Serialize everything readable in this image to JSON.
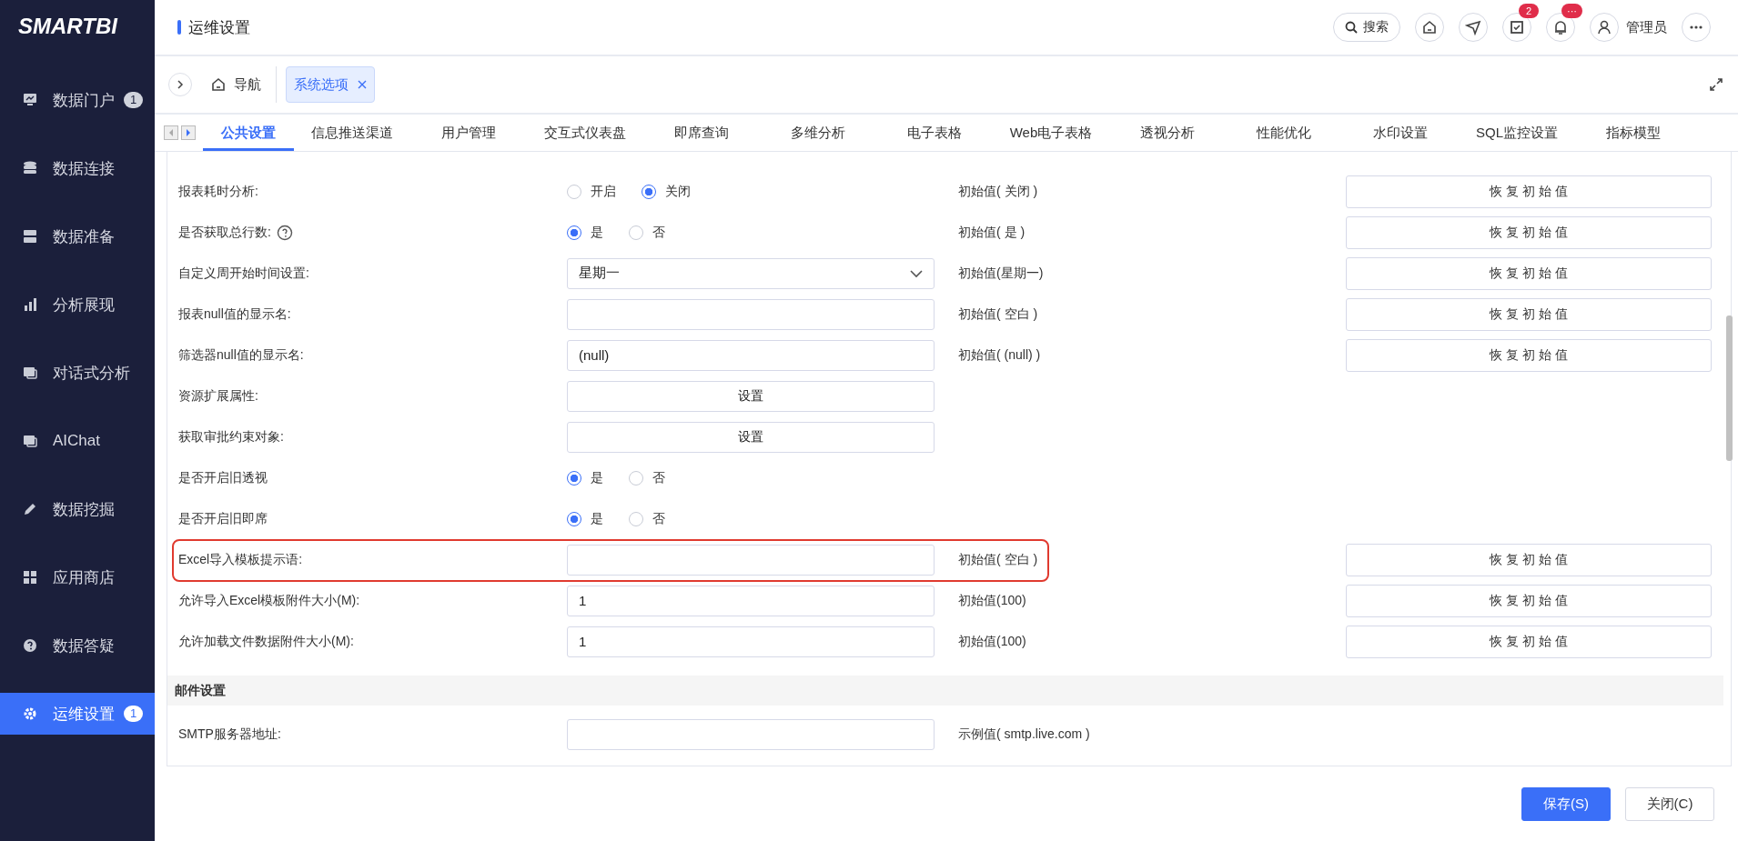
{
  "sidebar": {
    "logo": "SMARTBI",
    "items": [
      {
        "label": "数据门户",
        "badge": "1",
        "selected": false
      },
      {
        "label": "数据连接",
        "selected": false
      },
      {
        "label": "数据准备",
        "selected": false
      },
      {
        "label": "分析展现",
        "selected": false
      },
      {
        "label": "对话式分析",
        "selected": false
      },
      {
        "label": "AIChat",
        "selected": false
      },
      {
        "label": "数据挖掘",
        "selected": false
      },
      {
        "label": "应用商店",
        "selected": false
      },
      {
        "label": "数据答疑",
        "selected": false
      },
      {
        "label": "运维设置",
        "badge": "1",
        "selected": true
      }
    ]
  },
  "header": {
    "title": "运维设置",
    "search": "搜索",
    "badges": [
      "2",
      "···"
    ],
    "user": "管理员"
  },
  "nav": {
    "home": "导航",
    "tabs": [
      {
        "label": "系统选项",
        "selected": true
      }
    ]
  },
  "subtabs": [
    {
      "label": "公共设置",
      "selected": true
    },
    {
      "label": "信息推送渠道",
      "selected": false
    },
    {
      "label": "用户管理",
      "selected": false
    },
    {
      "label": "交互式仪表盘",
      "selected": false
    },
    {
      "label": "即席查询",
      "selected": false
    },
    {
      "label": "多维分析",
      "selected": false
    },
    {
      "label": "电子表格",
      "selected": false
    },
    {
      "label": "Web电子表格",
      "selected": false
    },
    {
      "label": "透视分析",
      "selected": false
    },
    {
      "label": "性能优化",
      "selected": false
    },
    {
      "label": "水印设置",
      "selected": false
    },
    {
      "label": "SQL监控设置",
      "selected": false
    },
    {
      "label": "指标模型",
      "selected": false
    }
  ],
  "rows": [
    {
      "kind": "radio",
      "label": "报表耗时分析:",
      "help": false,
      "options": [
        {
          "label": "开启",
          "selected": false
        },
        {
          "label": "关闭",
          "selected": true
        }
      ],
      "initial": "初始值( 关闭 )",
      "restore": "恢 复 初 始 值",
      "highlighted": false
    },
    {
      "kind": "radio",
      "label": "是否获取总行数:",
      "help": true,
      "options": [
        {
          "label": "是",
          "selected": true
        },
        {
          "label": "否",
          "selected": false
        }
      ],
      "initial": "初始值( 是 )",
      "restore": "恢 复 初 始 值",
      "highlighted": false
    },
    {
      "kind": "select",
      "label": "自定义周开始时间设置:",
      "help": false,
      "value": "星期一",
      "initial": "初始值(星期一)",
      "restore": "恢 复 初 始 值",
      "highlighted": false
    },
    {
      "kind": "input",
      "label": "报表null值的显示名:",
      "help": false,
      "initial": "初始值( 空白 )",
      "restore": "恢 复 初 始 值",
      "highlighted": false
    },
    {
      "kind": "input",
      "label": "筛选器null值的显示名:",
      "help": false,
      "value": "(null)",
      "initial": "初始值( (null) )",
      "restore": "恢 复 初 始 值",
      "highlighted": false
    },
    {
      "kind": "button",
      "label": "资源扩展属性:",
      "help": false,
      "value": "设置",
      "highlighted": false
    },
    {
      "kind": "button",
      "label": "获取审批约束对象:",
      "help": false,
      "value": "设置",
      "highlighted": false
    },
    {
      "kind": "radio",
      "label": "是否开启旧透视",
      "help": false,
      "options": [
        {
          "label": "是",
          "selected": true
        },
        {
          "label": "否",
          "selected": false
        }
      ],
      "highlighted": false
    },
    {
      "kind": "radio",
      "label": "是否开启旧即席",
      "help": false,
      "options": [
        {
          "label": "是",
          "selected": true
        },
        {
          "label": "否",
          "selected": false
        }
      ],
      "highlighted": false
    },
    {
      "kind": "input",
      "label": "Excel导入模板提示语:",
      "help": false,
      "initial": "初始值( 空白 )",
      "restore": "恢 复 初 始 值",
      "highlighted": true
    },
    {
      "kind": "input",
      "label": "允许导入Excel模板附件大小(M):",
      "help": false,
      "value": "1",
      "initial": "初始值(100)",
      "restore": "恢 复 初 始 值",
      "highlighted": false
    },
    {
      "kind": "input",
      "label": "允许加载文件数据附件大小(M):",
      "help": false,
      "value": "1",
      "initial": "初始值(100)",
      "restore": "恢 复 初 始 值",
      "highlighted": false
    },
    {
      "kind": "section",
      "label": "邮件设置"
    },
    {
      "kind": "input",
      "label": "SMTP服务器地址:",
      "help": false,
      "initial": "示例值( smtp.live.com )",
      "highlighted": false
    }
  ],
  "footer": {
    "save": "保存(S)",
    "close": "关闭(C)"
  }
}
